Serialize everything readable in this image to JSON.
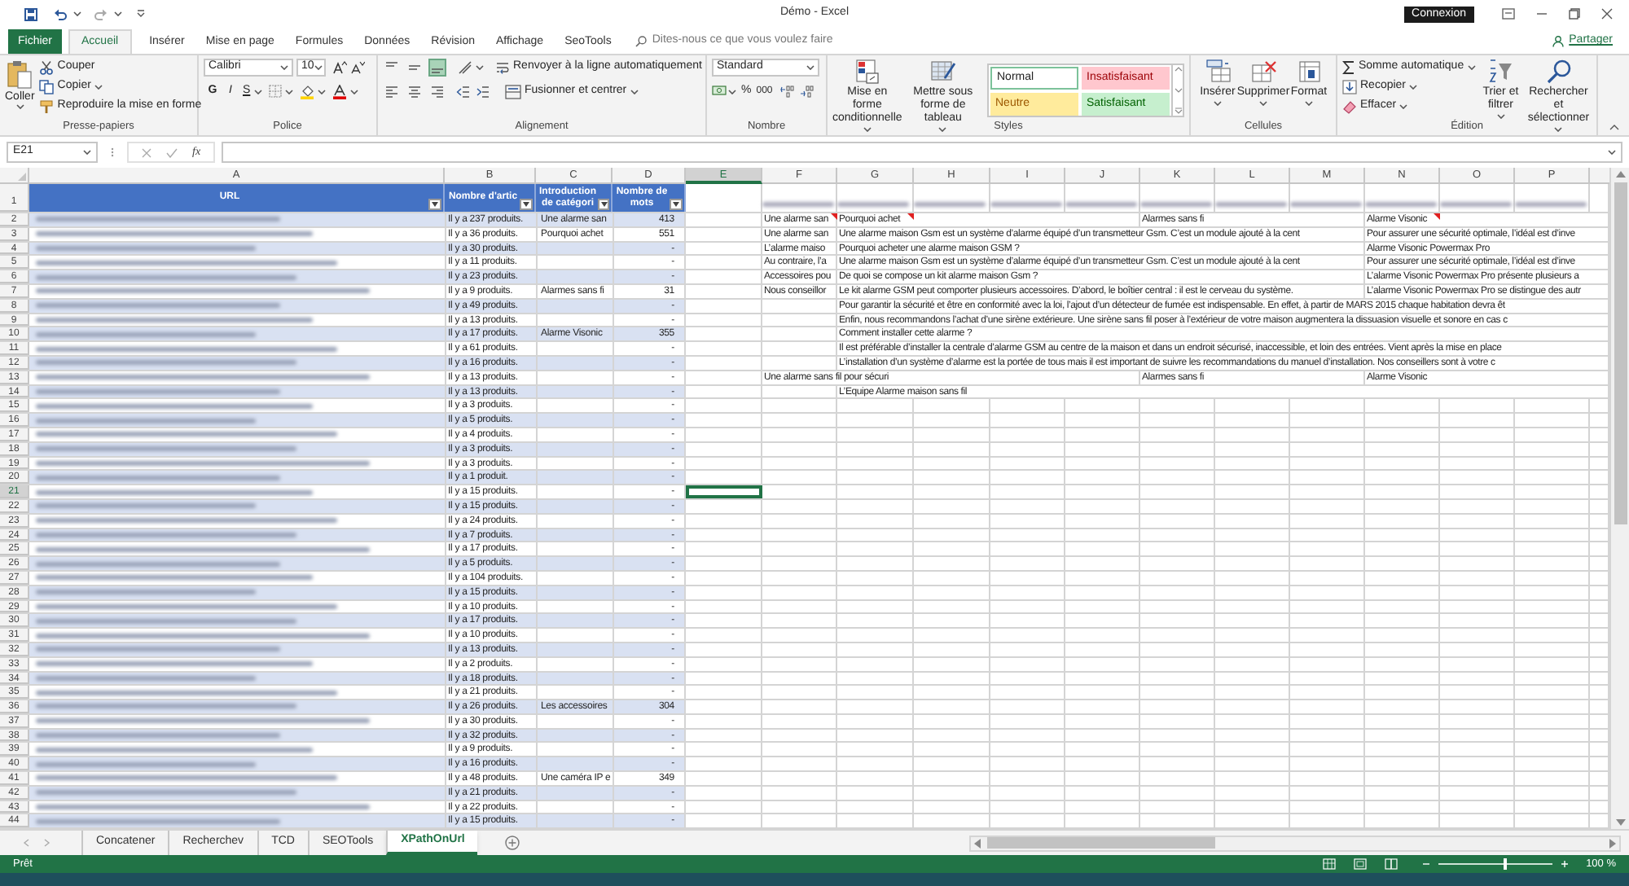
{
  "window": {
    "title": "Démo - Excel",
    "sign_in": "Connexion"
  },
  "ribbon_tabs": [
    {
      "label": "Fichier",
      "kind": "file",
      "selected": false
    },
    {
      "label": "Accueil",
      "kind": "tab",
      "selected": true
    },
    {
      "label": "Insérer",
      "kind": "tab",
      "selected": false
    },
    {
      "label": "Mise en page",
      "kind": "tab",
      "selected": false
    },
    {
      "label": "Formules",
      "kind": "tab",
      "selected": false
    },
    {
      "label": "Données",
      "kind": "tab",
      "selected": false
    },
    {
      "label": "Révision",
      "kind": "tab",
      "selected": false
    },
    {
      "label": "Affichage",
      "kind": "tab",
      "selected": false
    },
    {
      "label": "SeoTools",
      "kind": "tab",
      "selected": false
    }
  ],
  "tell_me": {
    "placeholder": "Dites-nous ce que vous voulez faire"
  },
  "share": "Partager",
  "ribbon": {
    "clipboard": {
      "label": "Presse-papiers",
      "paste": "Coller",
      "cut": "Couper",
      "copy": "Copier",
      "format_painter": "Reproduire la mise en forme"
    },
    "font": {
      "label": "Police",
      "font_name": "Calibri",
      "font_size": "10",
      "bold": "G",
      "italic": "I",
      "underline": "S"
    },
    "alignment": {
      "label": "Alignement",
      "wrap_text": "Renvoyer à la ligne automatiquement",
      "merge": "Fusionner et centrer",
      "vertical_align": [
        {
          "kind": "top",
          "selected": false
        },
        {
          "kind": "middle",
          "selected": false
        },
        {
          "kind": "bottom",
          "selected": true
        }
      ]
    },
    "number": {
      "label": "Nombre",
      "format": "Standard",
      "percent": "%",
      "thousands": "000"
    },
    "styles": {
      "label": "Styles",
      "conditional": "Mise en forme conditionnelle",
      "as_table": "Mettre sous forme de tableau",
      "gallery": [
        {
          "label": "Normal",
          "kind": "normal"
        },
        {
          "label": "Insatisfaisant",
          "kind": "bad"
        },
        {
          "label": "Neutre",
          "kind": "neutral"
        },
        {
          "label": "Satisfaisant",
          "kind": "good"
        }
      ]
    },
    "cells": {
      "label": "Cellules",
      "buttons": [
        {
          "label": "Insérer",
          "kind": "insert"
        },
        {
          "label": "Supprimer",
          "kind": "delete"
        },
        {
          "label": "Format",
          "kind": "format"
        }
      ]
    },
    "editing": {
      "label": "Édition",
      "autosum": "Somme automatique",
      "fill": "Recopier",
      "clear": "Effacer",
      "sort": "Trier et filtrer",
      "find": "Rechercher et sélectionner"
    }
  },
  "formula_bar": {
    "name_box": "E21",
    "function": "fx"
  },
  "sheet": {
    "columns": [
      {
        "label": "A",
        "selected": false
      },
      {
        "label": "B",
        "selected": false
      },
      {
        "label": "C",
        "selected": false
      },
      {
        "label": "D",
        "selected": false
      },
      {
        "label": "E",
        "selected": true
      },
      {
        "label": "F",
        "selected": false
      },
      {
        "label": "G",
        "selected": false
      },
      {
        "label": "H",
        "selected": false
      },
      {
        "label": "I",
        "selected": false
      },
      {
        "label": "J",
        "selected": false
      },
      {
        "label": "K",
        "selected": false
      },
      {
        "label": "L",
        "selected": false
      },
      {
        "label": "M",
        "selected": false
      },
      {
        "label": "N",
        "selected": false
      },
      {
        "label": "O",
        "selected": false
      },
      {
        "label": "P",
        "selected": false
      }
    ],
    "header": {
      "row": "1",
      "cells": [
        "URL",
        "Nombre d'artic",
        "Introduction de catégori",
        "Nombre de mots"
      ]
    },
    "rows": [
      {
        "row": "2",
        "selected": false,
        "b": "Il y a 237 produits.",
        "c": "Une alarme san",
        "d": "413",
        "cells": {
          "F": {
            "text": "Une alarme san",
            "note": true
          },
          "G": {
            "text": "Pourquoi achet",
            "note": true
          },
          "K": {
            "text": "Alarmes sans fi",
            "note": false
          },
          "N": {
            "text": "Alarme Visonic",
            "note": true
          }
        }
      },
      {
        "row": "3",
        "selected": false,
        "b": "Il y a 36 produits.",
        "c": "Pourquoi achet",
        "d": "551",
        "cells": {
          "F": {
            "text": "Une alarme san",
            "note": false
          },
          "G": {
            "text": "Une alarme maison Gsm est un système d’alarme équipé d’un transmetteur Gsm. C’est un module ajouté à la cent",
            "note": false
          },
          "N": {
            "text": "Pour assurer une sécurité optimale, l’idéal est d’inve",
            "note": false
          }
        }
      },
      {
        "row": "4",
        "selected": false,
        "b": "Il y a 30 produits.",
        "d": "-",
        "cells": {
          "F": {
            "text": "L’alarme maiso",
            "note": false
          },
          "G": {
            "text": "Pourquoi acheter une alarme maison GSM ?",
            "note": false
          },
          "N": {
            "text": "Alarme Visonic Powermax Pro",
            "note": false
          }
        }
      },
      {
        "row": "5",
        "selected": false,
        "b": "Il y a 11 produits.",
        "d": "-",
        "cells": {
          "F": {
            "text": "Au contraire, l’a",
            "note": false
          },
          "G": {
            "text": "Une alarme maison Gsm est un système d’alarme équipé d’un transmetteur Gsm. C’est un module ajouté à la cent",
            "note": false
          },
          "N": {
            "text": "Pour assurer une sécurité optimale, l’idéal est d’inve",
            "note": false
          }
        }
      },
      {
        "row": "6",
        "selected": false,
        "b": "Il y a 23 produits.",
        "d": "-",
        "cells": {
          "F": {
            "text": "Accessoires pou",
            "note": false
          },
          "G": {
            "text": "De quoi se compose un kit alarme maison Gsm ?",
            "note": false
          },
          "N": {
            "text": "L’alarme Visonic Powermax Pro présente plusieurs a",
            "note": false
          }
        }
      },
      {
        "row": "7",
        "selected": false,
        "b": "Il y a 9 produits.",
        "c": "Alarmes sans fi",
        "d": "31",
        "cells": {
          "F": {
            "text": "Nous conseillor",
            "note": false
          },
          "G": {
            "text": "Le kit alarme GSM peut comporter plusieurs accessoires. D’abord, le boîtier central : il est le cerveau du système.",
            "note": false
          },
          "N": {
            "text": "L’alarme Visonic Powermax Pro se distingue des autr",
            "note": false
          }
        }
      },
      {
        "row": "8",
        "selected": false,
        "b": "Il y a 49 produits.",
        "d": "-",
        "cells": {
          "G": {
            "text": "Pour garantir la sécurité et être en conformité avec la loi, l’ajout d’un détecteur de fumée est indispensable. En effet, à partir de MARS 2015 chaque habitation devra êt",
            "note": false
          }
        }
      },
      {
        "row": "9",
        "selected": false,
        "b": "Il y a 13 produits.",
        "d": "-",
        "cells": {
          "G": {
            "text": "Enfin, nous recommandons l’achat d’une sirène extérieure. Une sirène sans fil poser à l’extérieur de votre maison augmentera la dissuasion visuelle et sonore en cas c",
            "note": false
          }
        }
      },
      {
        "row": "10",
        "selected": false,
        "b": "Il y a 17 produits.",
        "c": "Alarme Visonic",
        "d": "355",
        "cells": {
          "G": {
            "text": "Comment installer cette alarme ?",
            "note": false
          }
        }
      },
      {
        "row": "11",
        "selected": false,
        "b": "Il y a 61 produits.",
        "d": "-",
        "cells": {
          "G": {
            "text": "Il est préférable d’installer la centrale d’alarme GSM au centre de la maison et dans un endroit sécurisé, inaccessible, et loin des entrées. Vient après la mise en place",
            "note": false
          }
        }
      },
      {
        "row": "12",
        "selected": false,
        "b": "Il y a 16 produits.",
        "d": "-",
        "cells": {
          "G": {
            "text": "L’installation d’un système d’alarme est la portée de tous mais il est important de suivre les recommandations du manuel d’installation. Nos conseillers sont à votre c",
            "note": false
          }
        }
      },
      {
        "row": "13",
        "selected": false,
        "b": "Il y a 13 produits.",
        "d": "-",
        "cells": {
          "F": {
            "text": "Une alarme sans fil pour sécuri",
            "note": false
          },
          "K": {
            "text": "Alarmes sans fi",
            "note": false
          },
          "N": {
            "text": "Alarme Visonic",
            "note": false
          }
        }
      },
      {
        "row": "14",
        "selected": false,
        "b": "Il y a 13 produits.",
        "d": "-",
        "cells": {
          "G": {
            "text": "L’Equipe Alarme maison sans fil",
            "note": false
          }
        }
      },
      {
        "row": "15",
        "selected": false,
        "b": "Il y a 3 produits.",
        "d": "-"
      },
      {
        "row": "16",
        "selected": false,
        "b": "Il y a 5 produits.",
        "d": "-"
      },
      {
        "row": "17",
        "selected": false,
        "b": "Il y a 4 produits.",
        "d": "-"
      },
      {
        "row": "18",
        "selected": false,
        "b": "Il y a 3 produits.",
        "d": "-"
      },
      {
        "row": "19",
        "selected": false,
        "b": "Il y a 3 produits.",
        "d": "-"
      },
      {
        "row": "20",
        "selected": false,
        "b": "Il y a 1 produit.",
        "d": "-"
      },
      {
        "row": "21",
        "selected": true,
        "b": "Il y a 15 produits.",
        "d": "-"
      },
      {
        "row": "22",
        "selected": false,
        "b": "Il y a 15 produits.",
        "d": "-"
      },
      {
        "row": "23",
        "selected": false,
        "b": "Il y a 24 produits.",
        "d": "-"
      },
      {
        "row": "24",
        "selected": false,
        "b": "Il y a 7 produits.",
        "d": "-"
      },
      {
        "row": "25",
        "selected": false,
        "b": "Il y a 17 produits.",
        "d": "-"
      },
      {
        "row": "26",
        "selected": false,
        "b": "Il y a 5 produits.",
        "d": "-"
      },
      {
        "row": "27",
        "selected": false,
        "b": "Il y a 104 produits.",
        "d": "-"
      },
      {
        "row": "28",
        "selected": false,
        "b": "Il y a 15 produits.",
        "d": "-"
      },
      {
        "row": "29",
        "selected": false,
        "b": "Il y a 10 produits.",
        "d": "-"
      },
      {
        "row": "30",
        "selected": false,
        "b": "Il y a 17 produits.",
        "d": "-"
      },
      {
        "row": "31",
        "selected": false,
        "b": "Il y a 10 produits.",
        "d": "-"
      },
      {
        "row": "32",
        "selected": false,
        "b": "Il y a 13 produits.",
        "d": "-"
      },
      {
        "row": "33",
        "selected": false,
        "b": "Il y a 2 produits.",
        "d": "-"
      },
      {
        "row": "34",
        "selected": false,
        "b": "Il y a 18 produits.",
        "d": "-"
      },
      {
        "row": "35",
        "selected": false,
        "b": "Il y a 21 produits.",
        "d": "-"
      },
      {
        "row": "36",
        "selected": false,
        "b": "Il y a 26 produits.",
        "c": "Les accessoires",
        "d": "304"
      },
      {
        "row": "37",
        "selected": false,
        "b": "Il y a 30 produits.",
        "d": "-"
      },
      {
        "row": "38",
        "selected": false,
        "b": "Il y a 32 produits.",
        "d": "-"
      },
      {
        "row": "39",
        "selected": false,
        "b": "Il y a 9 produits.",
        "d": "-"
      },
      {
        "row": "40",
        "selected": false,
        "b": "Il y a 16 produits.",
        "d": "-"
      },
      {
        "row": "41",
        "selected": false,
        "b": "Il y a 48 produits.",
        "c": "Une caméra IP e",
        "d": "349"
      },
      {
        "row": "42",
        "selected": false,
        "b": "Il y a 21 produits.",
        "d": "-"
      },
      {
        "row": "43",
        "selected": false,
        "b": "Il y a 22 produits.",
        "d": "-"
      },
      {
        "row": "44",
        "selected": false,
        "b": "Il y a 15 produits.",
        "d": "-"
      }
    ]
  },
  "sheet_tabs": [
    {
      "label": "Concatener",
      "selected": false
    },
    {
      "label": "Recherchev",
      "selected": false
    },
    {
      "label": "TCD",
      "selected": false
    },
    {
      "label": "SEOTools",
      "selected": false
    },
    {
      "label": "XPathOnUrl",
      "selected": true
    }
  ],
  "status_bar": {
    "text": "Prêt",
    "zoom": "100 %",
    "zoom_slider": {
      "level": 0.6
    }
  }
}
